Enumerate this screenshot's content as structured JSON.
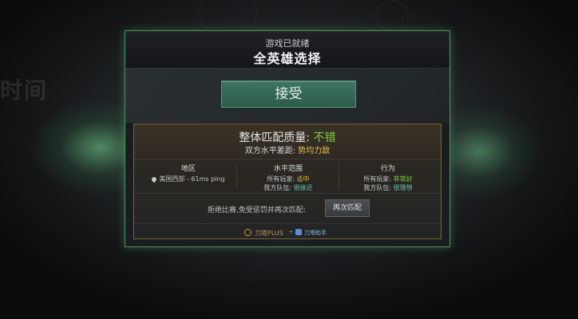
{
  "background": {
    "text": "时间"
  },
  "header": {
    "status": "游戏已就绪",
    "mode": "全英雄选择"
  },
  "accept_button": "接受",
  "match_quality": {
    "label": "整体匹配质量:",
    "value": "不错",
    "skill_gap_label": "双方水平差距:",
    "skill_gap_value": "势均力敌",
    "region": {
      "header": "地区",
      "value": "美国西部 - 61ms ping"
    },
    "skill_range": {
      "header": "水平范围",
      "all_players_label": "所有玩家:",
      "all_players_value": "适中",
      "your_team_label": "我方队伍:",
      "your_team_value": "很接近"
    },
    "behavior": {
      "header": "行为",
      "all_players_label": "所有玩家:",
      "all_players_value": "非常好",
      "your_team_label": "我方队伍:",
      "your_team_value": "很理想"
    },
    "decline_text": "拒绝比赛,免受惩罚并再次匹配:",
    "rematch_button": "再次匹配"
  },
  "footer": {
    "plus_label": "刀塔PLUS",
    "separator": "+",
    "assist_label": "刀塔助手"
  },
  "colors": {
    "accent_green": "#7ccf4a",
    "accent_yellow": "#e0b840",
    "modal_border": "#4e8f5c"
  }
}
